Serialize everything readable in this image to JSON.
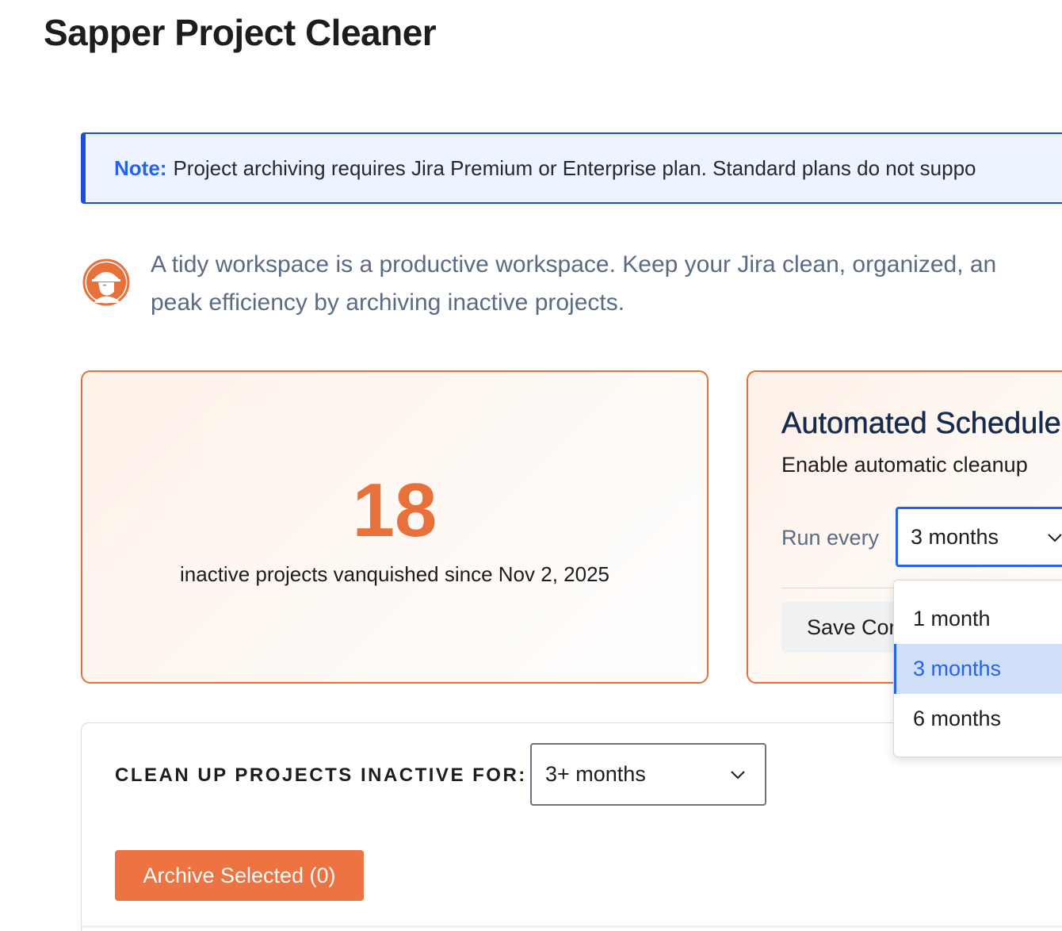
{
  "app": {
    "title": "Sapper Project Cleaner"
  },
  "note": {
    "label": "Note:",
    "text": "Project archiving requires Jira Premium or Enterprise plan. Standard plans do not suppo"
  },
  "intro": {
    "icon": "sapper-mascot-icon",
    "line1": "A tidy workspace is a productive workspace. Keep your Jira clean, organized, an",
    "line2": "peak efficiency by archiving inactive projects."
  },
  "stats": {
    "value": "18",
    "caption": "inactive projects vanquished since Nov 2, 2025"
  },
  "schedule": {
    "title": "Automated Schedule",
    "subtitle": "Enable automatic cleanup",
    "run_every_label": "Run every",
    "selected_interval": "3 months",
    "save_label": "Save Configuration",
    "options": [
      {
        "label": "1 month",
        "selected": false
      },
      {
        "label": "3 months",
        "selected": true
      },
      {
        "label": "6 months",
        "selected": false
      }
    ]
  },
  "cleanup": {
    "label": "CLEAN UP PROJECTS INACTIVE FOR:",
    "selected_period": "3+ months",
    "archive_label": "Archive Selected (0)"
  },
  "colors": {
    "accent_orange": "#e8703a",
    "info_blue": "#2563eb",
    "selected_option_bg": "#cfdff9"
  }
}
